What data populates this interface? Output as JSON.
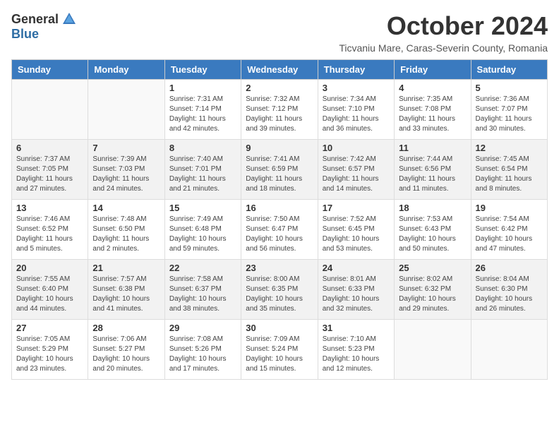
{
  "header": {
    "logo_general": "General",
    "logo_blue": "Blue",
    "month_title": "October 2024",
    "location": "Ticvaniu Mare, Caras-Severin County, Romania"
  },
  "days_of_week": [
    "Sunday",
    "Monday",
    "Tuesday",
    "Wednesday",
    "Thursday",
    "Friday",
    "Saturday"
  ],
  "weeks": [
    [
      {
        "day": "",
        "info": ""
      },
      {
        "day": "",
        "info": ""
      },
      {
        "day": "1",
        "info": "Sunrise: 7:31 AM\nSunset: 7:14 PM\nDaylight: 11 hours and 42 minutes."
      },
      {
        "day": "2",
        "info": "Sunrise: 7:32 AM\nSunset: 7:12 PM\nDaylight: 11 hours and 39 minutes."
      },
      {
        "day": "3",
        "info": "Sunrise: 7:34 AM\nSunset: 7:10 PM\nDaylight: 11 hours and 36 minutes."
      },
      {
        "day": "4",
        "info": "Sunrise: 7:35 AM\nSunset: 7:08 PM\nDaylight: 11 hours and 33 minutes."
      },
      {
        "day": "5",
        "info": "Sunrise: 7:36 AM\nSunset: 7:07 PM\nDaylight: 11 hours and 30 minutes."
      }
    ],
    [
      {
        "day": "6",
        "info": "Sunrise: 7:37 AM\nSunset: 7:05 PM\nDaylight: 11 hours and 27 minutes."
      },
      {
        "day": "7",
        "info": "Sunrise: 7:39 AM\nSunset: 7:03 PM\nDaylight: 11 hours and 24 minutes."
      },
      {
        "day": "8",
        "info": "Sunrise: 7:40 AM\nSunset: 7:01 PM\nDaylight: 11 hours and 21 minutes."
      },
      {
        "day": "9",
        "info": "Sunrise: 7:41 AM\nSunset: 6:59 PM\nDaylight: 11 hours and 18 minutes."
      },
      {
        "day": "10",
        "info": "Sunrise: 7:42 AM\nSunset: 6:57 PM\nDaylight: 11 hours and 14 minutes."
      },
      {
        "day": "11",
        "info": "Sunrise: 7:44 AM\nSunset: 6:56 PM\nDaylight: 11 hours and 11 minutes."
      },
      {
        "day": "12",
        "info": "Sunrise: 7:45 AM\nSunset: 6:54 PM\nDaylight: 11 hours and 8 minutes."
      }
    ],
    [
      {
        "day": "13",
        "info": "Sunrise: 7:46 AM\nSunset: 6:52 PM\nDaylight: 11 hours and 5 minutes."
      },
      {
        "day": "14",
        "info": "Sunrise: 7:48 AM\nSunset: 6:50 PM\nDaylight: 11 hours and 2 minutes."
      },
      {
        "day": "15",
        "info": "Sunrise: 7:49 AM\nSunset: 6:48 PM\nDaylight: 10 hours and 59 minutes."
      },
      {
        "day": "16",
        "info": "Sunrise: 7:50 AM\nSunset: 6:47 PM\nDaylight: 10 hours and 56 minutes."
      },
      {
        "day": "17",
        "info": "Sunrise: 7:52 AM\nSunset: 6:45 PM\nDaylight: 10 hours and 53 minutes."
      },
      {
        "day": "18",
        "info": "Sunrise: 7:53 AM\nSunset: 6:43 PM\nDaylight: 10 hours and 50 minutes."
      },
      {
        "day": "19",
        "info": "Sunrise: 7:54 AM\nSunset: 6:42 PM\nDaylight: 10 hours and 47 minutes."
      }
    ],
    [
      {
        "day": "20",
        "info": "Sunrise: 7:55 AM\nSunset: 6:40 PM\nDaylight: 10 hours and 44 minutes."
      },
      {
        "day": "21",
        "info": "Sunrise: 7:57 AM\nSunset: 6:38 PM\nDaylight: 10 hours and 41 minutes."
      },
      {
        "day": "22",
        "info": "Sunrise: 7:58 AM\nSunset: 6:37 PM\nDaylight: 10 hours and 38 minutes."
      },
      {
        "day": "23",
        "info": "Sunrise: 8:00 AM\nSunset: 6:35 PM\nDaylight: 10 hours and 35 minutes."
      },
      {
        "day": "24",
        "info": "Sunrise: 8:01 AM\nSunset: 6:33 PM\nDaylight: 10 hours and 32 minutes."
      },
      {
        "day": "25",
        "info": "Sunrise: 8:02 AM\nSunset: 6:32 PM\nDaylight: 10 hours and 29 minutes."
      },
      {
        "day": "26",
        "info": "Sunrise: 8:04 AM\nSunset: 6:30 PM\nDaylight: 10 hours and 26 minutes."
      }
    ],
    [
      {
        "day": "27",
        "info": "Sunrise: 7:05 AM\nSunset: 5:29 PM\nDaylight: 10 hours and 23 minutes."
      },
      {
        "day": "28",
        "info": "Sunrise: 7:06 AM\nSunset: 5:27 PM\nDaylight: 10 hours and 20 minutes."
      },
      {
        "day": "29",
        "info": "Sunrise: 7:08 AM\nSunset: 5:26 PM\nDaylight: 10 hours and 17 minutes."
      },
      {
        "day": "30",
        "info": "Sunrise: 7:09 AM\nSunset: 5:24 PM\nDaylight: 10 hours and 15 minutes."
      },
      {
        "day": "31",
        "info": "Sunrise: 7:10 AM\nSunset: 5:23 PM\nDaylight: 10 hours and 12 minutes."
      },
      {
        "day": "",
        "info": ""
      },
      {
        "day": "",
        "info": ""
      }
    ]
  ]
}
